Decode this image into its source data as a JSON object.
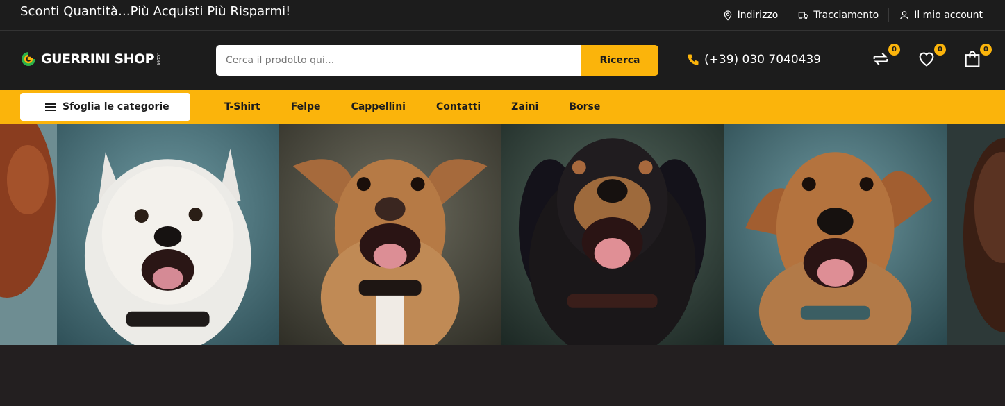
{
  "topbar": {
    "promo": "Sconti Quantità...Più Acquisti Più Risparmi!",
    "links": [
      {
        "label": "Indirizzo",
        "icon": "map-pin-icon"
      },
      {
        "label": "Tracciamento",
        "icon": "truck-icon"
      },
      {
        "label": "Il mio account",
        "icon": "user-icon"
      }
    ]
  },
  "header": {
    "logo": {
      "text": "GUERRINI SHOP",
      "suffix": ".COM"
    },
    "search": {
      "placeholder": "Cerca il prodotto qui...",
      "button": "Ricerca"
    },
    "phone": "(+39) 030 7040439",
    "icons": [
      {
        "name": "compare-icon",
        "count": "0"
      },
      {
        "name": "heart-icon",
        "count": "0"
      },
      {
        "name": "cart-icon",
        "count": "0"
      }
    ]
  },
  "nav": {
    "categories_button": "Sfoglia le categorie",
    "links": [
      "T-Shirt",
      "Felpe",
      "Cappellini",
      "Contatti",
      "Zaini",
      "Borse"
    ]
  },
  "colors": {
    "accent": "#fbb40b",
    "dark": "#1c1c1c",
    "background": "#231f20"
  }
}
